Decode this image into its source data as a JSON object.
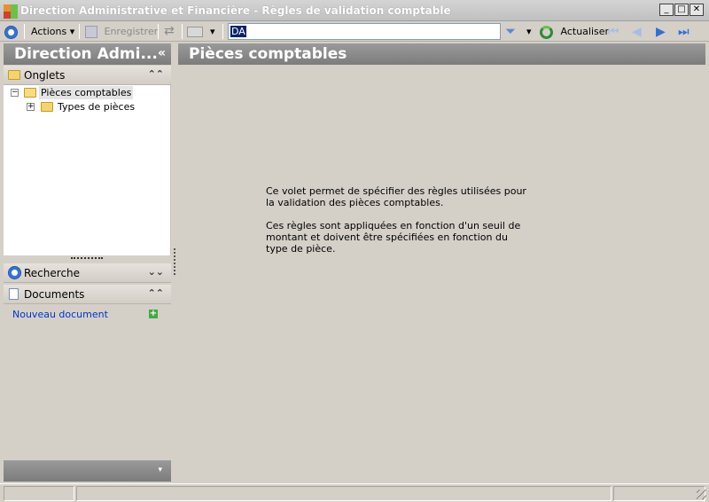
{
  "window": {
    "title": "Direction Administrative et Financière -  Règles de validation comptable",
    "minimize": "_",
    "maximize": "□",
    "close": "✕"
  },
  "toolbar": {
    "actions_label": "Actions",
    "save_label": "Enregistrer",
    "search_value": "DA",
    "refresh_label": "Actualiser",
    "dropdown_glyph": "▾",
    "icons": {
      "main": "blue-circle-icon",
      "save": "save-icon",
      "sync": "sync-icon",
      "print": "printer-icon",
      "filter": "funnel-icon",
      "refresh": "refresh-icon",
      "first": "first-page-icon",
      "prev": "previous-icon",
      "next": "next-icon",
      "last": "last-page-icon"
    }
  },
  "left_pane": {
    "header_title": "Direction Admi...",
    "collapse_glyph": "«",
    "sections": {
      "tabs": {
        "label": "Onglets",
        "chevron": "⌃⌃"
      },
      "search": {
        "label": "Recherche",
        "chevron": "⌄⌄"
      },
      "documents": {
        "label": "Documents",
        "chevron": "⌃⌃"
      }
    },
    "tree": [
      {
        "label": "Pièces comptables",
        "expander": "−",
        "selected": true
      },
      {
        "label": "Types de pièces",
        "expander": "+",
        "selected": false
      }
    ],
    "new_document_link": "Nouveau document",
    "add_glyph": "+",
    "bottom_chevron": "▾"
  },
  "main_pane": {
    "title": "Pièces comptables",
    "paragraphs": [
      "Ce volet permet de spécifier des règles utilisées pour la validation des pièces comptables.",
      "Ces règles sont appliquées en fonction d'un seuil de montant et doivent être spécifiées en fonction du type de pièce."
    ]
  },
  "colors": {
    "header_gray": "#8a8a8a",
    "link_blue": "#0033cc",
    "selection_navy": "#0a246a",
    "nav_blue": "#2e6fd8"
  }
}
